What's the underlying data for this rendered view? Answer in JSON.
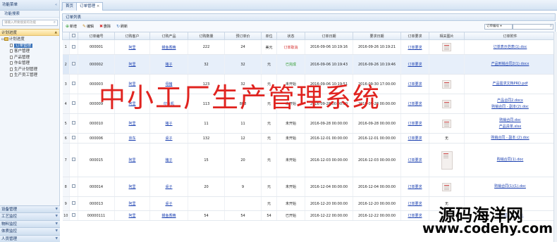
{
  "sidebar": {
    "title": "功能菜单",
    "collapse_symbol": "«",
    "sub_title": "功能搜索",
    "search_placeholder": "请输入所要搜索的功能",
    "section_title": "计划进度",
    "tree_root": "计划进度",
    "tree_items": [
      "订单管理",
      "客户管理",
      "产品管理",
      "作业管理",
      "生产计划管理",
      "生产员工管理"
    ],
    "bottom_sections": [
      "设备管理",
      "工艺监控",
      "物料监控",
      "体质监控",
      "人员管理"
    ]
  },
  "tabs": [
    "首页",
    "订单管理"
  ],
  "tab_close": "×",
  "list_title": "订单列表",
  "toolbar": {
    "add": "新增",
    "edit": "编辑",
    "delete": "删除",
    "refresh": "刷新",
    "filter_select": "订单编号"
  },
  "columns": [
    "",
    "订单编号",
    "订购客户",
    "订购产品",
    "订购数量",
    "预订单价",
    "单位",
    "状态",
    "订单日期",
    "要求日期",
    "订单要求",
    "相关图片",
    "订单附件"
  ],
  "rows": [
    {
      "n": "1",
      "id": "000001",
      "cust": "阿里",
      "prod": "鳗鱼香精",
      "qty": "222",
      "price": "24",
      "unit": "美元",
      "status": "订单取消",
      "odate": "2016-09-06 10:19:16",
      "rdate": "2016-09-26 10:19:21",
      "req": "订单要求",
      "img": "thumb",
      "att": [
        "订单表示范表(1).doc"
      ]
    },
    {
      "n": "2",
      "id": "000002",
      "cust": "阿里",
      "prod": "猪子",
      "qty": "32",
      "price": "32",
      "unit": "元",
      "status": "已完成",
      "odate": "2016-09-06 10:19:43",
      "rdate": "2016-09-26 10:19:46",
      "req": "订单要求",
      "img": "",
      "att": [
        "产品到销合同2(1).docx"
      ]
    },
    {
      "n": "3",
      "id": "000003",
      "cust": "阿里",
      "prod": "母猪",
      "qty": "123",
      "price": "32",
      "unit": "元",
      "status": "未开始",
      "odate": "2016-09-06 10:19:51",
      "rdate": "2016-09-30 17:00:00",
      "req": "订单要求",
      "img": "thumb",
      "att": [
        "产品需求文档PRD.pdf"
      ]
    },
    {
      "n": "4",
      "id": "000009",
      "cust": "阿里",
      "prod": "印象机",
      "qty": "113",
      "price": "888",
      "unit": "元",
      "status": "未开始",
      "odate": "2016-09-28 00:00:00",
      "rdate": "2016-09-28 00:00:00",
      "req": "订单要求",
      "img": "thumb",
      "att": [
        "产品合同2.docx",
        "购销合同 - 副本(2).doc"
      ]
    },
    {
      "n": "5",
      "id": "000010",
      "cust": "阿里",
      "prod": "猪子",
      "qty": "11",
      "price": "11",
      "unit": "元",
      "status": "未开始",
      "odate": "2016-09-28 00:00:00",
      "rdate": "2016-09-28 00:00:00",
      "req": "订单要求",
      "img": "thumb",
      "att": [
        "购销合同.doc",
        "产品清单.xlsx"
      ]
    },
    {
      "n": "6",
      "id": "000006",
      "cust": "京东",
      "prod": "桌子",
      "qty": "132",
      "price": "12",
      "unit": "元",
      "status": "未开始",
      "odate": "2016-12-01 00:00:00",
      "rdate": "2016-12-01 00:00:00",
      "req": "订单要求",
      "img": "无",
      "att": [
        "购销合同 - 副本 (2).doc"
      ]
    },
    {
      "n": "7",
      "id": "000015",
      "cust": "阿里",
      "prod": "猪子",
      "qty": "15",
      "price": "20",
      "unit": "元",
      "status": "未开始",
      "odate": "2016-12-03 00:00:00",
      "rdate": "2016-12-03 00:00:00",
      "req": "订单要求",
      "img": "tall",
      "att": [
        "购销合同(1).doc"
      ]
    },
    {
      "n": "8",
      "id": "000014",
      "cust": "阿里",
      "prod": "桌子",
      "qty": "20",
      "price": "9",
      "unit": "元",
      "status": "未开始",
      "odate": "2016-12-04 00:00:00",
      "rdate": "2016-12-04 00:00:00",
      "req": "订单要求",
      "img": "thumb",
      "att": [
        "购销合同(1)(1).doc"
      ]
    },
    {
      "n": "9",
      "id": "000013",
      "cust": "阿里",
      "prod": "桌子",
      "qty": "",
      "price": "",
      "unit": "元",
      "status": "未开始",
      "odate": "2016-12-20 00:00:00",
      "rdate": "2016-12-20 00:00:00",
      "req": "订单要求",
      "img": "无",
      "att": [
        ""
      ]
    },
    {
      "n": "10",
      "id": "00000111",
      "cust": "阿里",
      "prod": "鳗鱼香精",
      "qty": "54",
      "price": "54",
      "unit": "54",
      "status": "已开始",
      "odate": "2016-12-22 00:00:00",
      "rdate": "2016-12-22 00:00:00",
      "req": "订单要求",
      "img": "",
      "att": [
        "订单表示(1).doc"
      ]
    }
  ],
  "watermark": "中小工厂生产管理系统",
  "brand_cn": "源码海洋网",
  "brand_url": "www.codehy.com",
  "colors": {
    "status_cancel": "#d42b2b",
    "status_done": "#2b9a2b",
    "link": "#1a3fb0",
    "selected_tree": "#3b73b9",
    "watermark": "#e0231f"
  }
}
